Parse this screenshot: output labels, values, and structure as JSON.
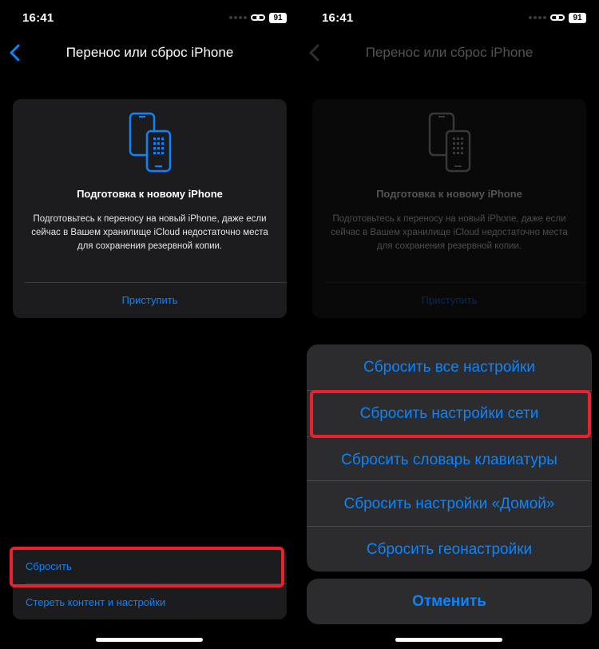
{
  "status": {
    "time": "16:41",
    "battery": "91"
  },
  "nav": {
    "title": "Перенос или сброс iPhone"
  },
  "card": {
    "title": "Подготовка к новому iPhone",
    "description": "Подготовьтесь к переносу на новый iPhone, даже если сейчас в Вашем хранилище iCloud недостаточно места для сохранения резервной копии.",
    "action": "Приступить",
    "icon": "two-phones-icon"
  },
  "bottom": {
    "reset": "Сбросить",
    "erase": "Стереть контент и настройки"
  },
  "sheet": {
    "items": [
      "Сбросить все настройки",
      "Сбросить настройки сети",
      "Сбросить словарь клавиатуры",
      "Сбросить настройки «Домой»",
      "Сбросить геонастройки"
    ],
    "cancel": "Отменить"
  },
  "colors": {
    "accent": "#0a84ff",
    "highlight": "#e8212f",
    "card_bg": "#1c1c1e",
    "sheet_bg": "#2c2c2e"
  }
}
